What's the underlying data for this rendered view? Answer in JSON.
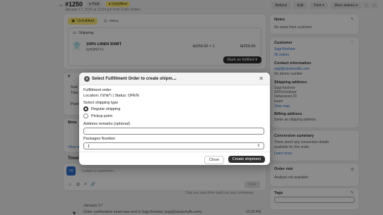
{
  "header": {
    "back_icon": "arrow-left-icon",
    "order_number": "#1250",
    "payment_badge": "● Paid",
    "fulfillment_badge": "● Unfulfilled",
    "subtitle": "January 17, 2025 at 12:24 pm from Draft Orders",
    "actions": [
      "Refund",
      "Edit",
      "Print ▾",
      "More actions ▾"
    ],
    "nav": [
      "‹",
      "›"
    ]
  },
  "fulfillment_card": {
    "status_pill": "Unfulfilled",
    "location_pill": "nwcs",
    "shipping_label": "Shipping",
    "item": {
      "name": "100% LINEN SHIRT",
      "sku": "SHOPIFY1",
      "price_qty": "₪259.00 × 1",
      "total": "₪259.00"
    },
    "mark_button": "Mark as fulfilled ▾"
  },
  "payment_card": {
    "header": "P",
    "lines": [
      "Sub",
      "Tota",
      "",
      "Paid"
    ]
  },
  "metafields_card": {
    "header": "Meta",
    "link": "View a"
  },
  "timeline": {
    "label": "Timel",
    "avatar": "TK",
    "comment_placeholder": "Leave a comment...",
    "tools": [
      "☺",
      "@",
      "#",
      "🔗"
    ],
    "post_label": "Post",
    "only_you_note": "Only you and other staff can see comments",
    "date": "January 17",
    "event": "Order confirmation email was sent to Sagi Kirshner (sagi@sizzlemuffs.com).",
    "event_time": "12:26 PM"
  },
  "sidebar": {
    "notes": {
      "title": "Notes",
      "text": "No notes from customer"
    },
    "customer": {
      "title": "Customer",
      "name": "Sagi Kirshner",
      "orders": "35 orders",
      "contact_title": "Contact information",
      "email": "sagi@sizzlemuffs.com",
      "phone": "No phone number",
      "shipping_title": "Shipping address",
      "address_lines": [
        "Sagi Kirshner",
        "ZATA Kirshner",
        "Vaharavani 20",
        "Israel"
      ],
      "map_link": "View map",
      "billing_title": "Billing address",
      "billing_text": "Same as shipping address"
    },
    "conversion": {
      "title": "Conversion summary",
      "text_1": "There aren't any conversion details",
      "text_2": "available for this order.",
      "link": "Learn more"
    },
    "risk": {
      "title": "Order risk",
      "text": "Analysis not available"
    },
    "tags": {
      "title": "Tags"
    }
  },
  "modal": {
    "title": "Select Fulfillment Order to create shipm...",
    "chevron": "⌄",
    "close": "✕",
    "order_heading": "Fulfillment order",
    "order_info": "Location: רשתות | Status: OPEN",
    "shipping_type_label": "Select shipping type",
    "options": [
      "Regular shipping",
      "Pickup point"
    ],
    "selected_option": "Regular shipping",
    "remarks_label": "Address remarks (optional)",
    "remarks_value": "",
    "packages_label": "Packages Number",
    "packages_value": "1",
    "close_button": "Close",
    "create_button": "Create shipment"
  }
}
